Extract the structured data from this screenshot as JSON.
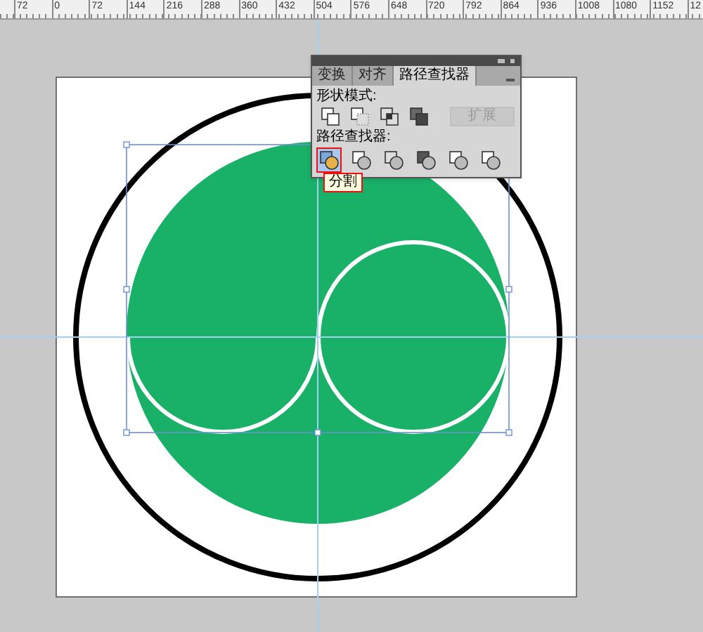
{
  "ruler": {
    "labels": [
      "72",
      "0",
      "72",
      "144",
      "216",
      "288",
      "360",
      "432",
      "504",
      "576",
      "648",
      "720",
      "792",
      "864",
      "936",
      "1008",
      "1080",
      "1152",
      "12"
    ]
  },
  "panel": {
    "tabs": [
      {
        "label": "变换",
        "selected": false
      },
      {
        "label": "对齐",
        "selected": false
      },
      {
        "label": "路径查找器",
        "selected": true
      }
    ],
    "shape_modes": {
      "label": "形状模式:",
      "expand_button": {
        "label": "扩展",
        "disabled": true
      }
    },
    "pathfinders": {
      "label": "路径查找器:",
      "buttons": [
        {
          "selected": true
        },
        {
          "selected": false
        },
        {
          "selected": false
        },
        {
          "selected": false
        },
        {
          "selected": false
        },
        {
          "selected": false
        }
      ]
    },
    "tooltip": "分割"
  }
}
